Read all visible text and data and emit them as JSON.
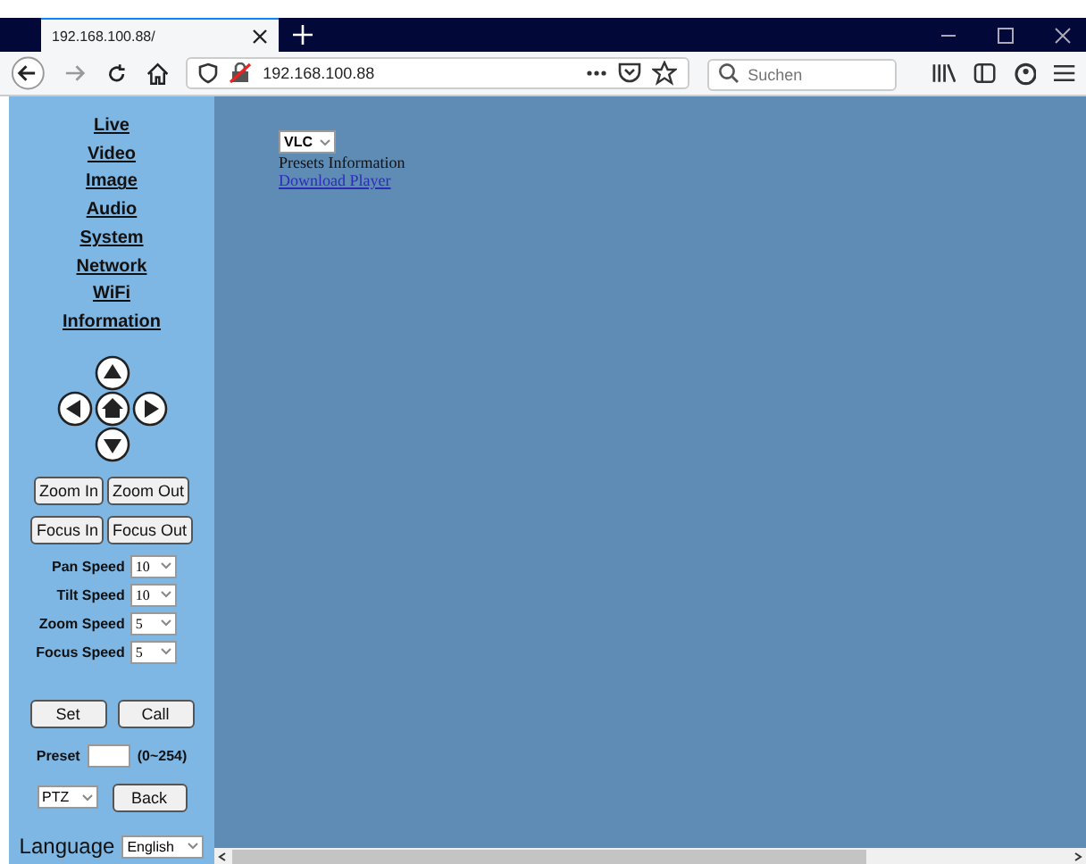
{
  "browser": {
    "tab_title": "192.168.100.88/",
    "address": "192.168.100.88",
    "search": {
      "placeholder": "Suchen"
    }
  },
  "sidebar": {
    "nav": [
      "Live",
      "Video",
      "Image",
      "Audio",
      "System",
      "Network",
      "WiFi",
      "Information"
    ],
    "zoom_buttons": [
      "Zoom In",
      "Zoom Out"
    ],
    "focus_buttons": [
      "Focus In",
      "Focus Out"
    ],
    "speeds": [
      {
        "label": "Pan Speed",
        "value": "10"
      },
      {
        "label": "Tilt Speed",
        "value": "10"
      },
      {
        "label": "Zoom Speed",
        "value": "5"
      },
      {
        "label": "Focus Speed",
        "value": "5"
      }
    ],
    "preset_buttons": [
      "Set",
      "Call"
    ],
    "preset": {
      "label": "Preset",
      "range": "(0~254)"
    },
    "mode": "PTZ",
    "back": "Back",
    "language": {
      "label": "Language",
      "value": "English"
    }
  },
  "main": {
    "player": "VLC",
    "info": "Presets Information",
    "link": "Download Player"
  }
}
